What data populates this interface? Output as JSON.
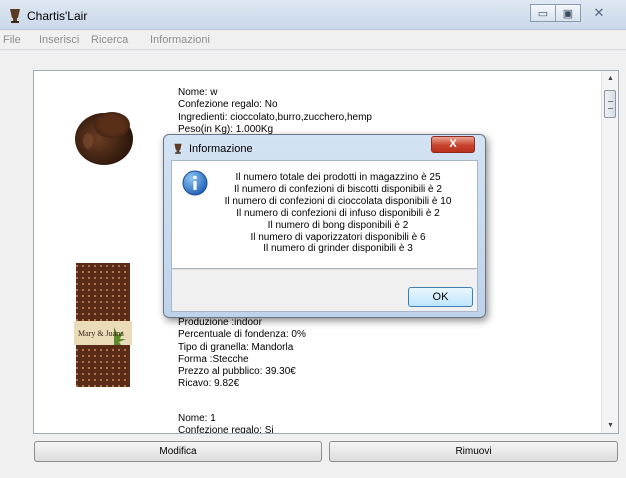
{
  "window": {
    "title": "Chartis'Lair"
  },
  "menu": [
    "File",
    "Inserisci",
    "Ricerca",
    "Informazioni"
  ],
  "products": [
    {
      "lines": [
        "Nome: w",
        "Confezione regalo: No",
        "Ingredienti: cioccolato,burro,zucchero,hemp",
        "Peso(in Kg): 1.000Kg"
      ]
    },
    {
      "lines": [
        "Produzione :indoor",
        "Percentuale di fondenza: 0%",
        "Tipo di granella: Mandorla",
        "Forma :Stecche",
        "Prezzo al pubblico: 39.30€",
        "Ricavo: 9.82€"
      ]
    },
    {
      "lines": [
        "Nome: 1",
        "Confezione regalo: Si"
      ]
    }
  ],
  "product_image_brand": "Mary & Juana",
  "buttons": {
    "modifica": "Modifica",
    "rimuovi": "Rimuovi"
  },
  "dialog": {
    "title": "Informazione",
    "close_label": "X",
    "messages": [
      "Il numero totale dei prodotti in magazzino è 25",
      "Il numero di confezioni di biscotti disponibili è 2",
      "Il numero di confezioni di cioccolata disponibili è 10",
      "Il numero di confezioni di infuso disponibili è 2",
      "Il numero di bong disponibili è 2",
      "Il numero di vaporizzatori disponibili è 6",
      "Il numero di grinder disponibili è 3"
    ],
    "ok_label": "OK"
  },
  "colors": {
    "accent": "#3c7fb1",
    "close": "#c8432d",
    "chocolate": "#4b2a1a"
  }
}
